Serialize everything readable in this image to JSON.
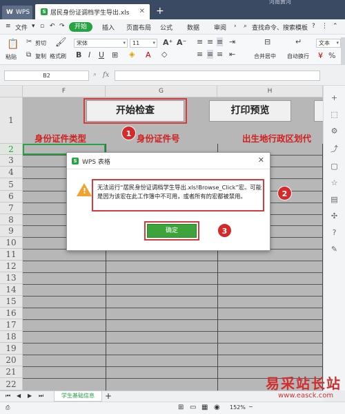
{
  "titlebar": {
    "app_tab": "WPS",
    "file_tab": "居民身份证调档学生导出.xls",
    "user": "河南黄河"
  },
  "menu": {
    "file": "文件",
    "items": [
      "开始",
      "插入",
      "页面布局",
      "公式",
      "数据",
      "审阅"
    ],
    "search": "查找命令、搜索模板"
  },
  "ribbon": {
    "paste": "粘贴",
    "cut": "剪切",
    "copy": "复制",
    "format_painter": "格式刷",
    "font_name": "宋体",
    "font_size": "11",
    "merge_center": "合并居中",
    "wrap": "自动换行",
    "text_format": "文本"
  },
  "formula_bar": {
    "cell_ref": "B2",
    "fx": "fx",
    "value": ""
  },
  "sheet": {
    "columns": [
      "F",
      "G",
      "H"
    ],
    "rows": [
      "1",
      "2",
      "3",
      "4",
      "5",
      "6",
      "7",
      "8",
      "9",
      "10",
      "11",
      "12",
      "13",
      "14",
      "15",
      "16",
      "17",
      "18",
      "19",
      "20",
      "21",
      "22"
    ],
    "btn_check": "开始检查",
    "btn_print": "打印预览",
    "header_id_type": "身份证件类型",
    "header_id_no": "身份证件号",
    "header_birthplace": "出生地行政区划代"
  },
  "sheet_tabs": {
    "active": "学生基础信息"
  },
  "status": {
    "zoom": "152%"
  },
  "dialog": {
    "title": "WPS 表格",
    "message": "无法运行“居民身份证调档学生导出.xls!Browse_Click”宏。可能是因为该宏在此工作簿中不可用，或者所有的宏都被禁用。",
    "ok": "确定"
  },
  "callouts": [
    "1",
    "2",
    "3"
  ],
  "watermark": {
    "line1": "易采站长站",
    "line2": "www.easck.com"
  },
  "colors": {
    "accent_green": "#27a345",
    "callout_red": "#d42a2a",
    "warning": "#f0a22d",
    "title_bar": "#3b4a63"
  }
}
